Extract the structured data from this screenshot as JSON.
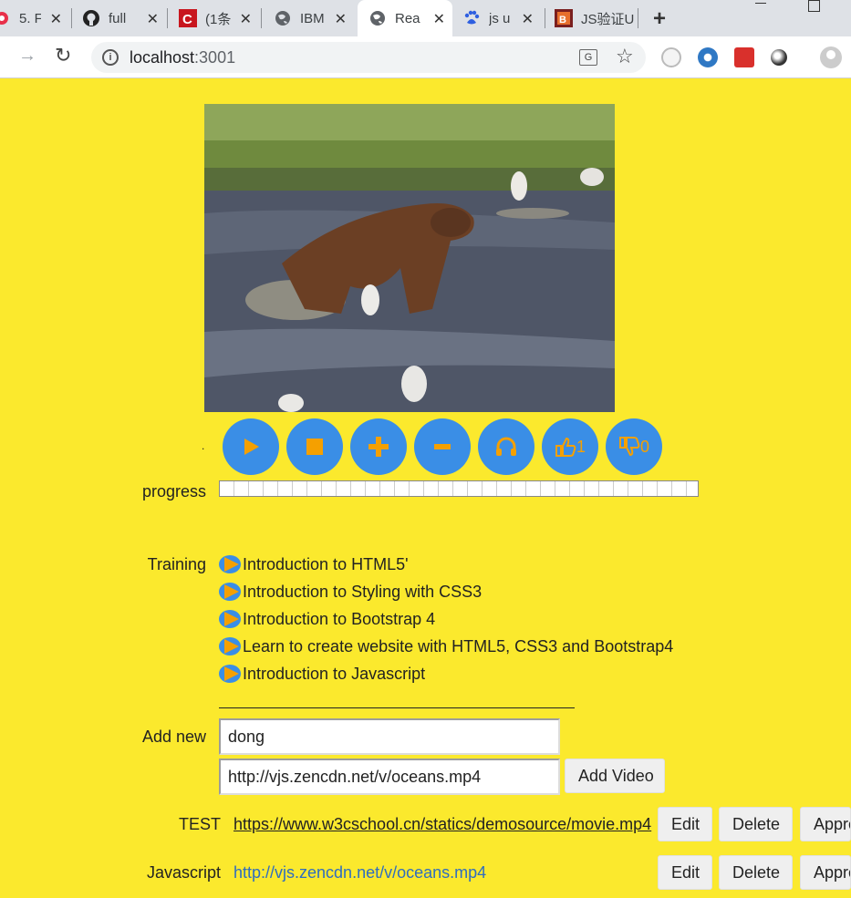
{
  "browser": {
    "tabs": [
      {
        "title": "5. F",
        "icon": "vivaldi-icon"
      },
      {
        "title": "full",
        "icon": "github-icon"
      },
      {
        "title": "(1条",
        "icon": "csdn-icon"
      },
      {
        "title": "IBM",
        "icon": "globe-icon"
      },
      {
        "title": "Rea",
        "icon": "globe-icon"
      },
      {
        "title": "js u",
        "icon": "baidu-icon"
      },
      {
        "title": "JS验证U",
        "icon": "jetbrains-icon"
      }
    ],
    "url_host": "localhost",
    "url_port": ":3001"
  },
  "player": {
    "dot": ".",
    "controls": [
      "play-button",
      "stop-button",
      "volume-up-button",
      "volume-down-button",
      "mute-button",
      "like-button",
      "dislike-button"
    ],
    "likes": "1",
    "dislikes": "0",
    "progress_label": "progress",
    "progress_value": 0
  },
  "training": {
    "label": "Training",
    "courses": [
      "Introduction to HTML5'",
      "Introduction to Styling with CSS3",
      "Introduction to Bootstrap 4",
      "Learn to create website with HTML5, CSS3 and Bootstrap4",
      "Introduction to Javascript"
    ]
  },
  "add_new": {
    "label": "Add new",
    "name_value": "dong",
    "url_value": "http://vjs.zencdn.net/v/oceans.mp4",
    "button": "Add Video"
  },
  "videos": [
    {
      "title": "TEST",
      "url": "https://www.w3cschool.cn/statics/demosource/movie.mp4",
      "edit": "Edit",
      "delete": "Delete",
      "approve": "Approve"
    },
    {
      "title": "Javascript",
      "url": "http://vjs.zencdn.net/v/oceans.mp4",
      "edit": "Edit",
      "delete": "Delete",
      "approve": "Approve"
    }
  ],
  "colors": {
    "page_bg": "#fbe92d",
    "button_blue": "#3a8ee6",
    "icon_orange": "#f5a000",
    "link": "#2f6dbf"
  }
}
